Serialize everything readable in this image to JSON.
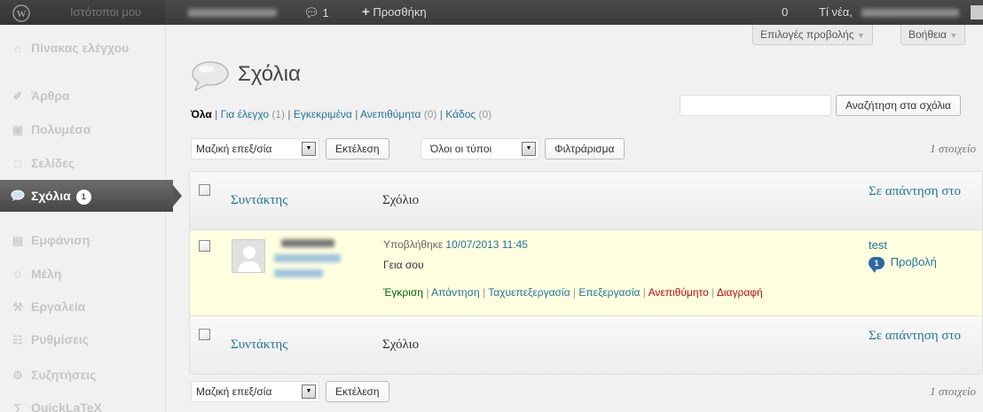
{
  "adminbar": {
    "sites_label": "Ιστότοποι μου",
    "comments_count": "1",
    "new_label": "Προσθήκη",
    "updates_count": "0",
    "greeting": "Τί νέα,"
  },
  "sidebar": {
    "items": [
      {
        "label": "Πίνακας ελέγχου",
        "icon": "dashboard-icon"
      },
      {
        "label": "Άρθρα",
        "icon": "pin-icon"
      },
      {
        "label": "Πολυμέσα",
        "icon": "media-icon"
      },
      {
        "label": "Σελίδες",
        "icon": "pages-icon"
      },
      {
        "label": "Σχόλια",
        "icon": "comments-icon",
        "badge": "1"
      },
      {
        "label": "Εμφάνιση",
        "icon": "appearance-icon"
      },
      {
        "label": "Μέλη",
        "icon": "users-icon"
      },
      {
        "label": "Εργαλεία",
        "icon": "tools-icon"
      },
      {
        "label": "Ρυθμίσεις",
        "icon": "settings-icon"
      },
      {
        "label": "Συζητήσεις",
        "icon": "discussion-icon"
      },
      {
        "label": "QuickLaTeX",
        "icon": "latex-icon"
      }
    ]
  },
  "screen_options": "Επιλογές προβολής",
  "help": "Βοήθεια",
  "page_title": "Σχόλια",
  "filters": {
    "all": "Όλα",
    "pending": "Για έλεγχο",
    "pending_count": "(1)",
    "approved": "Εγκεκριμένα",
    "spam": "Ανεπιθύμητα",
    "spam_count": "(0)",
    "trash": "Κάδος",
    "trash_count": "(0)"
  },
  "search_button": "Αναζήτηση στα σχόλια",
  "bulk_actions": "Μαζική επεξ/σία",
  "apply": "Εκτέλεση",
  "type_filter": "Όλοι οι τύποι",
  "filter_button": "Φιλτράρισμα",
  "items_count": "1 στοιχείο",
  "columns": {
    "author": "Συντάκτης",
    "comment": "Σχόλιο",
    "response": "Σε απάντηση στο"
  },
  "comment": {
    "submitted_prefix": "Υποβλήθηκε",
    "date": "10/07/2013 11:45",
    "text": "Γεια σου",
    "actions": {
      "approve": "Έγκριση",
      "reply": "Απάντηση",
      "quick_edit": "Ταχυεπεξεργασία",
      "edit": "Επεξεργασία",
      "spam": "Ανεπιθύμητο",
      "delete": "Διαγραφή"
    },
    "response_post": "test",
    "response_count": "1",
    "view": "Προβολή"
  },
  "colors": {
    "adminbar": "#464646",
    "link": "#21759b",
    "row_highlight": "#ffffe0",
    "delete_red": "#bc0b0b"
  }
}
